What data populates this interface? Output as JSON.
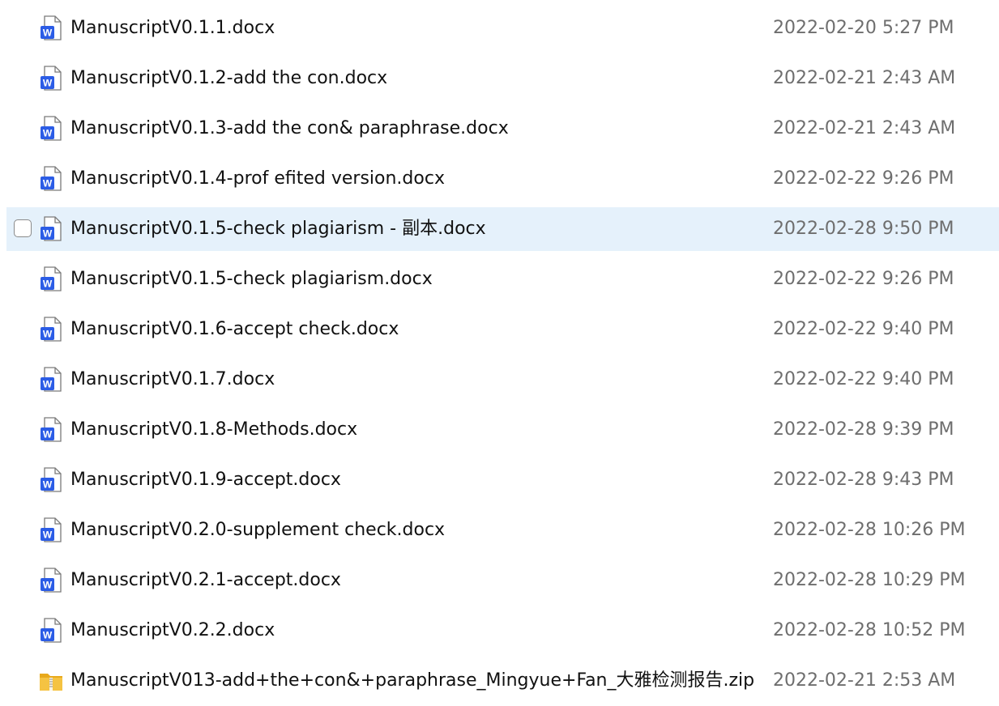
{
  "files": [
    {
      "name": "ManuscriptV0.1.1.docx",
      "date": "2022-02-20 5:27 PM",
      "icon": "word-doc-icon",
      "hovered": false
    },
    {
      "name": "ManuscriptV0.1.2-add the con.docx",
      "date": "2022-02-21 2:43 AM",
      "icon": "word-doc-icon",
      "hovered": false
    },
    {
      "name": "ManuscriptV0.1.3-add the con& paraphrase.docx",
      "date": "2022-02-21 2:43 AM",
      "icon": "word-doc-icon",
      "hovered": false
    },
    {
      "name": "ManuscriptV0.1.4-prof efited version.docx",
      "date": "2022-02-22 9:26 PM",
      "icon": "word-doc-icon",
      "hovered": false
    },
    {
      "name": "ManuscriptV0.1.5-check plagiarism - 副本.docx",
      "date": "2022-02-28 9:50 PM",
      "icon": "word-doc-icon",
      "hovered": true
    },
    {
      "name": "ManuscriptV0.1.5-check plagiarism.docx",
      "date": "2022-02-22 9:26 PM",
      "icon": "word-doc-icon",
      "hovered": false
    },
    {
      "name": "ManuscriptV0.1.6-accept check.docx",
      "date": "2022-02-22 9:40 PM",
      "icon": "word-doc-icon",
      "hovered": false
    },
    {
      "name": "ManuscriptV0.1.7.docx",
      "date": "2022-02-22 9:40 PM",
      "icon": "word-doc-icon",
      "hovered": false
    },
    {
      "name": "ManuscriptV0.1.8-Methods.docx",
      "date": "2022-02-28 9:39 PM",
      "icon": "word-doc-icon",
      "hovered": false
    },
    {
      "name": "ManuscriptV0.1.9-accept.docx",
      "date": "2022-02-28 9:43 PM",
      "icon": "word-doc-icon",
      "hovered": false
    },
    {
      "name": "ManuscriptV0.2.0-supplement check.docx",
      "date": "2022-02-28 10:26 PM",
      "icon": "word-doc-icon",
      "hovered": false
    },
    {
      "name": "ManuscriptV0.2.1-accept.docx",
      "date": "2022-02-28 10:29 PM",
      "icon": "word-doc-icon",
      "hovered": false
    },
    {
      "name": "ManuscriptV0.2.2.docx",
      "date": "2022-02-28 10:52 PM",
      "icon": "word-doc-icon",
      "hovered": false
    },
    {
      "name": "ManuscriptV013-add+the+con&+paraphrase_Mingyue+Fan_大雅检测报告.zip",
      "date": "2022-02-21 2:53 AM",
      "icon": "zip-folder-icon",
      "hovered": false
    }
  ],
  "colors": {
    "hover_bg": "#e5f1fb",
    "word_blue": "#2b5ce6",
    "zip_yellow": "#f5c342"
  }
}
